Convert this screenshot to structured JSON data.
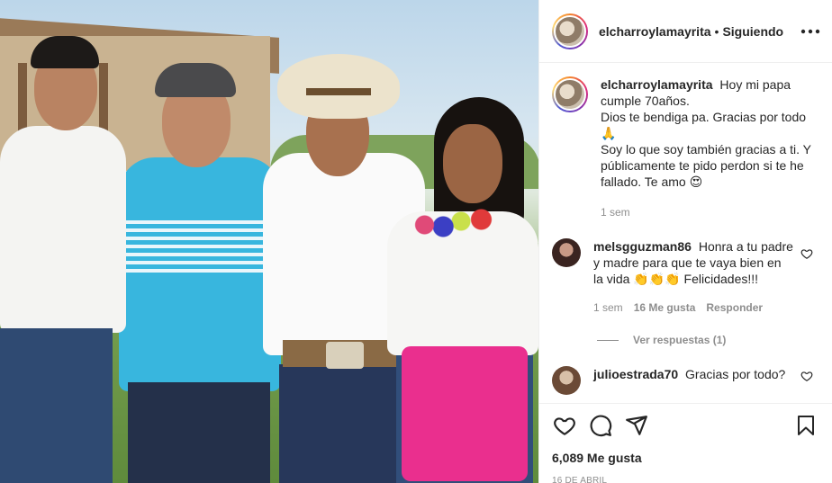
{
  "post": {
    "author": "elcharroylamayrita",
    "follow_separator": "•",
    "follow_status": "Siguiendo",
    "more_icon": "more-horizontal-icon",
    "photo_alt": "Foto de cuatro personas sonriendo al aire libre"
  },
  "caption": {
    "user": "elcharroylamayrita",
    "lines": [
      "Hoy mi papa cumple 70años.",
      "Dios te bendiga pa. Gracias por todo",
      "🙏",
      "Soy lo que soy también gracias a ti. Y públicamente te pido perdon si te he fallado. Te amo 😍"
    ],
    "time": "1 sem"
  },
  "comments": [
    {
      "user": "melsgguzman86",
      "text": "Honra a tu padre y madre para que te vaya bien en la vida 👏👏👏 Felicidades!!!",
      "time": "1 sem",
      "likes": "16 Me gusta",
      "reply": "Responder",
      "view_replies": "Ver respuestas (1)"
    },
    {
      "user": "julioestrada70",
      "text": "Gracias por todo?"
    }
  ],
  "actions": {
    "like_icon": "heart-icon",
    "comment_icon": "comment-icon",
    "share_icon": "paper-plane-icon",
    "save_icon": "bookmark-icon"
  },
  "likes_count": "6,089 Me gusta",
  "date": "16 DE ABRIL",
  "colors": {
    "text": "#262626",
    "secondary": "#8e8e8e",
    "border": "#efefef",
    "sash": "#ea2f8e",
    "polo": "#38b6de"
  }
}
